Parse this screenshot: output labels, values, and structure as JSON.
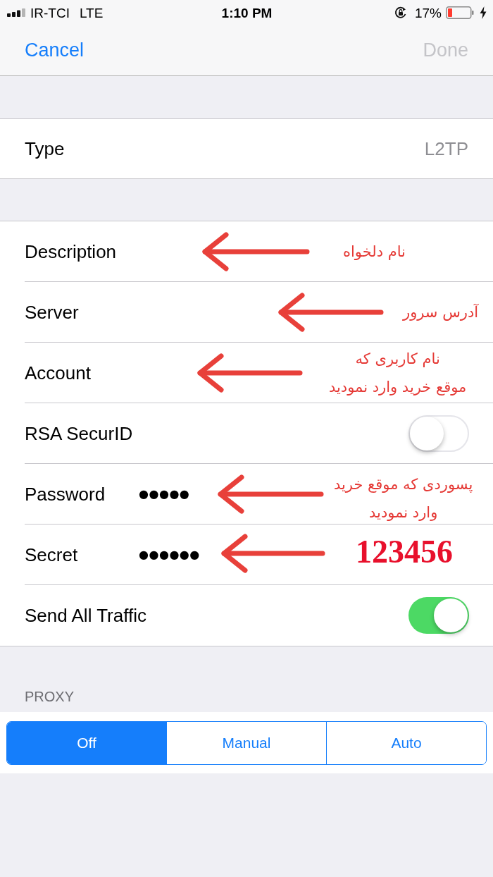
{
  "status_bar": {
    "carrier": "IR-TCI",
    "network": "LTE",
    "time": "1:10 PM",
    "battery_percent": "17%"
  },
  "nav_bar": {
    "cancel": "Cancel",
    "done": {
      "label": "Done",
      "disabled": true
    }
  },
  "type_row": {
    "label": "Type",
    "value": "L2TP"
  },
  "settings": [
    {
      "kind": "text",
      "label": "Description",
      "annotation": {
        "kind": "note",
        "lines": [
          "نام دلخواه"
        ]
      }
    },
    {
      "kind": "text",
      "label": "Server",
      "annotation": {
        "kind": "note",
        "lines": [
          "آدرس سرور"
        ]
      }
    },
    {
      "kind": "text",
      "label": "Account",
      "annotation": {
        "kind": "note",
        "lines": [
          "نام کاربری که",
          "موقع خرید وارد نمودید"
        ]
      }
    },
    {
      "kind": "switch",
      "label": "RSA SecurID",
      "on": false
    },
    {
      "kind": "secure",
      "label": "Password",
      "value": "●●●●●",
      "annotation": {
        "kind": "note",
        "lines": [
          "پسوردی که موقع خرید",
          "وارد نمودید"
        ]
      }
    },
    {
      "kind": "secure",
      "label": "Secret",
      "value": "●●●●●●",
      "annotation": {
        "kind": "number",
        "lines": [
          "123456"
        ]
      }
    },
    {
      "kind": "switch",
      "label": "Send All Traffic",
      "on": true
    }
  ],
  "proxy": {
    "header": "PROXY",
    "options": [
      {
        "label": "Off",
        "selected": true
      },
      {
        "label": "Manual",
        "selected": false
      },
      {
        "label": "Auto",
        "selected": false
      }
    ]
  }
}
